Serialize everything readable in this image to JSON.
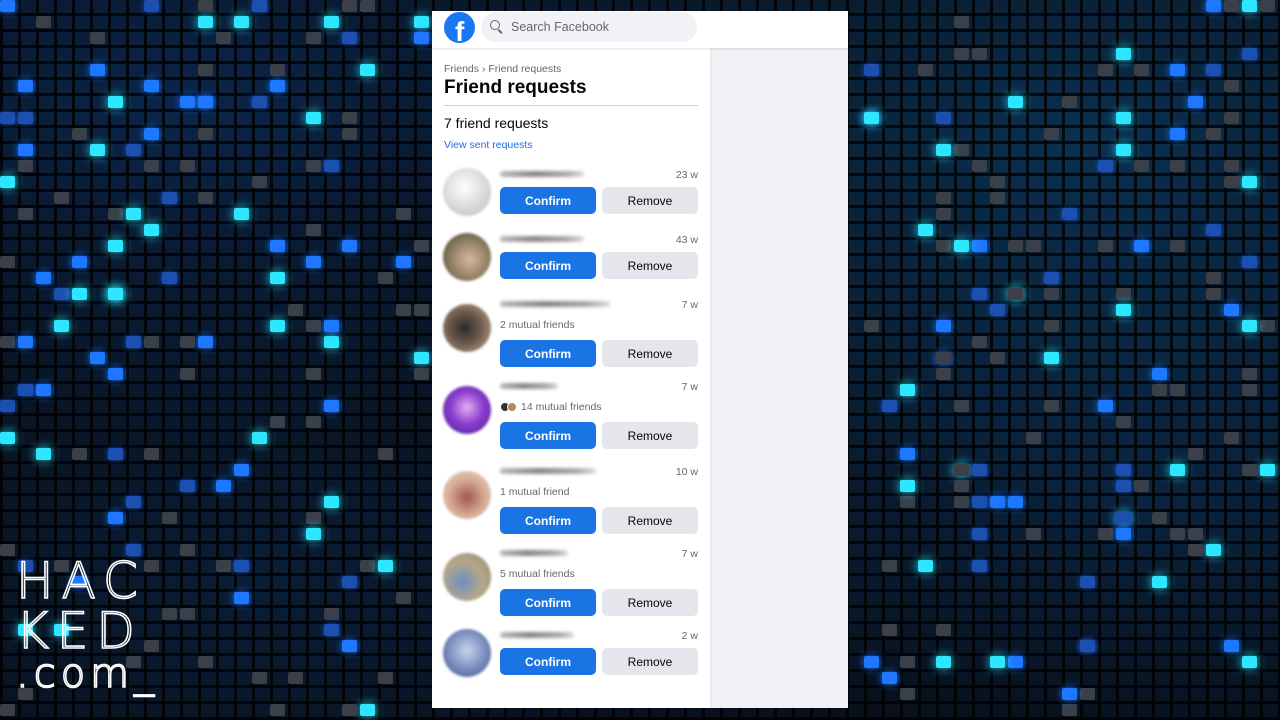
{
  "background": {
    "description": "digital number grid wallpaper",
    "colors": {
      "glow_cyan": "#2ee6ff",
      "glow_blue": "#1e78ff"
    }
  },
  "watermark": {
    "line1": "HAC",
    "line2": "KED",
    "line3": ".com_"
  },
  "topbar": {
    "logo_icon": "facebook-logo",
    "logo_glyph": "f",
    "search": {
      "icon": "search-icon",
      "placeholder": "Search Facebook",
      "value": ""
    }
  },
  "sidebar": {
    "breadcrumb": {
      "items": [
        "Friends",
        "Friend requests"
      ],
      "separator": "›"
    },
    "title": "Friend requests",
    "count_text": "7 friend requests",
    "view_sent_label": "View sent requests",
    "requests": [
      {
        "name": "[blurred]",
        "time": "23 w",
        "mutual": "",
        "confirm": "Confirm",
        "remove": "Remove"
      },
      {
        "name": "[blurred]",
        "time": "43 w",
        "mutual": "",
        "confirm": "Confirm",
        "remove": "Remove"
      },
      {
        "name": "[blurred]",
        "time": "7 w",
        "mutual": "2 mutual friends",
        "confirm": "Confirm",
        "remove": "Remove"
      },
      {
        "name": "[blurred]",
        "time": "7 w",
        "mutual": "14 mutual friends",
        "confirm": "Confirm",
        "remove": "Remove"
      },
      {
        "name": "[blurred]",
        "time": "10 w",
        "mutual": "1 mutual friend",
        "confirm": "Confirm",
        "remove": "Remove"
      },
      {
        "name": "[blurred]",
        "time": "7 w",
        "mutual": "5 mutual friends",
        "confirm": "Confirm",
        "remove": "Remove"
      },
      {
        "name": "[blurred]",
        "time": "2 w",
        "mutual": "",
        "confirm": "Confirm",
        "remove": "Remove"
      }
    ]
  },
  "colors": {
    "brand": "#1877f2",
    "confirm_bg": "#1b74e4",
    "remove_bg": "#e4e6eb",
    "link": "#216fdb",
    "secondary_text": "#65676b",
    "page_bg": "#f0f2f5"
  }
}
